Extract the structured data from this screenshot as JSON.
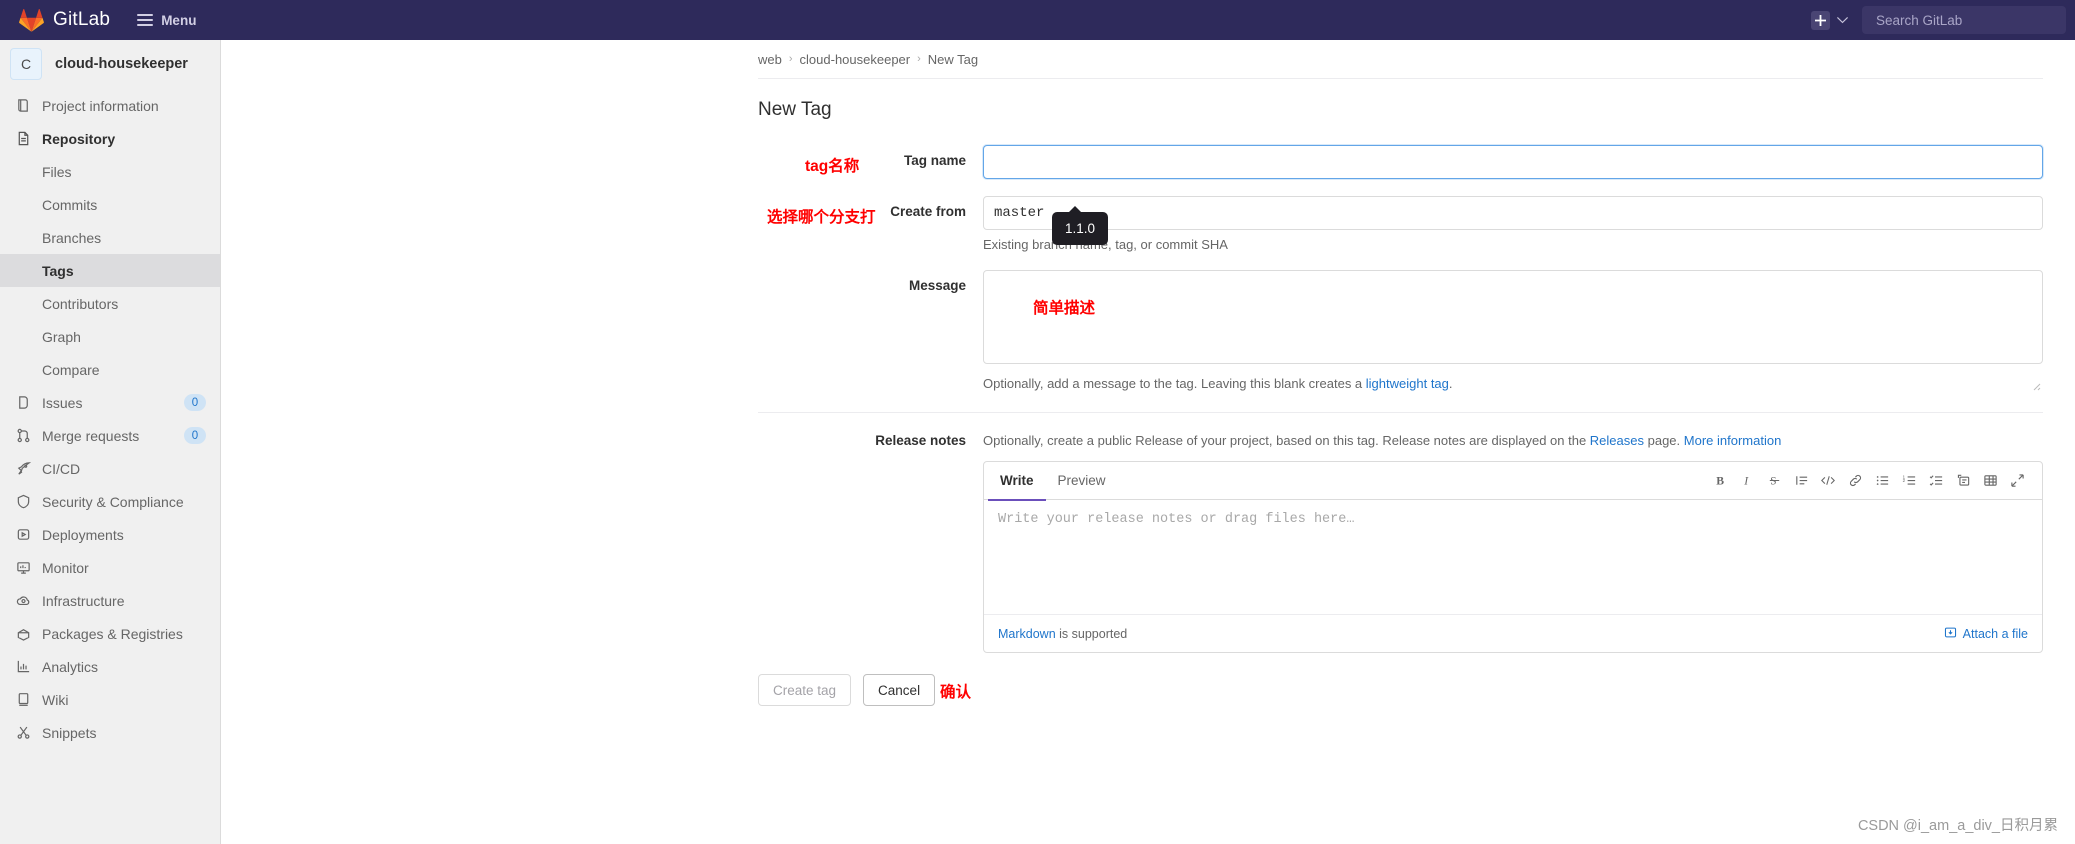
{
  "navbar": {
    "brand": "GitLab",
    "menu_label": "Menu",
    "plus_icon": "plus-icon",
    "chevron_icon": "chevron-down-icon",
    "search_placeholder": "Search GitLab"
  },
  "sidebar": {
    "project_initial": "C",
    "project_name": "cloud-housekeeper",
    "items": [
      {
        "label": "Project information",
        "icon": "book-icon",
        "level": "top"
      },
      {
        "label": "Repository",
        "icon": "document-icon",
        "level": "top",
        "strong": true
      },
      {
        "label": "Files",
        "level": "sub"
      },
      {
        "label": "Commits",
        "level": "sub"
      },
      {
        "label": "Branches",
        "level": "sub"
      },
      {
        "label": "Tags",
        "level": "sub",
        "active": true
      },
      {
        "label": "Contributors",
        "level": "sub"
      },
      {
        "label": "Graph",
        "level": "sub"
      },
      {
        "label": "Compare",
        "level": "sub"
      },
      {
        "label": "Issues",
        "icon": "issues-icon",
        "level": "top",
        "badge": "0"
      },
      {
        "label": "Merge requests",
        "icon": "merge-icon",
        "level": "top",
        "badge": "0"
      },
      {
        "label": "CI/CD",
        "icon": "rocket-icon",
        "level": "top"
      },
      {
        "label": "Security & Compliance",
        "icon": "shield-icon",
        "level": "top"
      },
      {
        "label": "Deployments",
        "icon": "deploy-icon",
        "level": "top"
      },
      {
        "label": "Monitor",
        "icon": "monitor-icon",
        "level": "top"
      },
      {
        "label": "Infrastructure",
        "icon": "cloud-gear-icon",
        "level": "top"
      },
      {
        "label": "Packages & Registries",
        "icon": "package-icon",
        "level": "top"
      },
      {
        "label": "Analytics",
        "icon": "chart-icon",
        "level": "top"
      },
      {
        "label": "Wiki",
        "icon": "wiki-icon",
        "level": "top"
      },
      {
        "label": "Snippets",
        "icon": "scissors-icon",
        "level": "top"
      }
    ]
  },
  "breadcrumb": {
    "item1": "web",
    "item2": "cloud-housekeeper",
    "item3": "New Tag",
    "separator": "›"
  },
  "page": {
    "title": "New Tag"
  },
  "form": {
    "tag_name": {
      "label": "Tag name",
      "value": "",
      "annotation": "tag名称"
    },
    "create_from": {
      "label": "Create from",
      "value": "master",
      "hint": "Existing branch name, tag, or commit SHA",
      "annotation": "选择哪个分支打"
    },
    "message": {
      "label": "Message",
      "value": "",
      "annotation": "简单描述",
      "hint_pre": "Optionally, add a message to the tag. Leaving this blank creates a ",
      "hint_link": "lightweight tag",
      "hint_post": "."
    },
    "release_notes": {
      "label": "Release notes",
      "hint_pre": "Optionally, create a public Release of your project, based on this tag. Release notes are displayed on the ",
      "hint_link1": "Releases",
      "hint_mid": " page. ",
      "hint_link2": "More information"
    }
  },
  "tooltip": {
    "text": "1.1.0"
  },
  "editor": {
    "tabs": [
      {
        "label": "Write",
        "active": true
      },
      {
        "label": "Preview",
        "active": false
      }
    ],
    "tools": [
      {
        "name": "bold-icon",
        "glyph": "B"
      },
      {
        "name": "italic-icon",
        "glyph": "I"
      },
      {
        "name": "strikethrough-icon",
        "glyph": "S"
      },
      {
        "name": "quote-icon",
        "glyph": ""
      },
      {
        "name": "code-icon",
        "glyph": "</>"
      },
      {
        "name": "link-icon",
        "glyph": ""
      },
      {
        "name": "bulleted-list-icon",
        "glyph": ""
      },
      {
        "name": "numbered-list-icon",
        "glyph": ""
      },
      {
        "name": "task-list-icon",
        "glyph": ""
      },
      {
        "name": "collapsible-section-icon",
        "glyph": ""
      },
      {
        "name": "table-icon",
        "glyph": ""
      },
      {
        "name": "fullscreen-icon",
        "glyph": ""
      }
    ],
    "placeholder": "Write your release notes or drag files here…",
    "footer_link": "Markdown",
    "footer_text": " is supported",
    "attach_label": "Attach a file",
    "attach_icon": "attach-image-icon"
  },
  "actions": {
    "create_label": "Create tag",
    "cancel_label": "Cancel",
    "annotation": "确认"
  },
  "watermark": "CSDN @i_am_a_div_日积月累",
  "colors": {
    "navbar": "#2e2a5b",
    "sidebar": "#f0f0f0",
    "accent": "#1f75cb",
    "annotation": "#ff0000",
    "tab_active": "#6b4fbb",
    "focus_border": "#63a6e9"
  }
}
